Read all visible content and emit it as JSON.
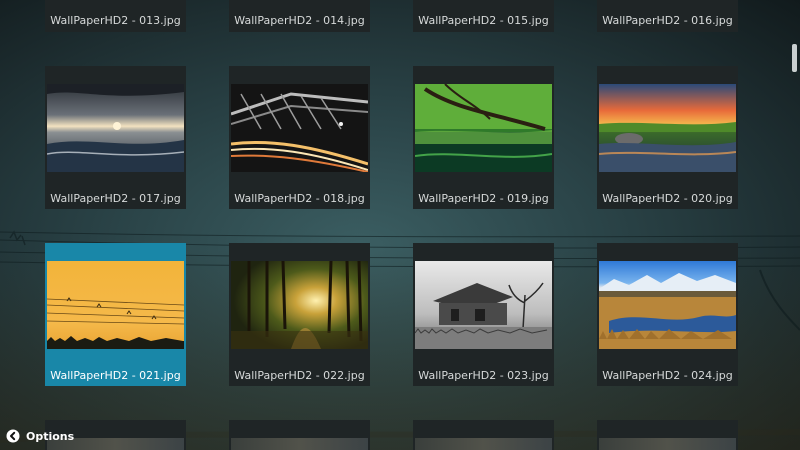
{
  "files": {
    "row_top": [
      "WallPaperHD2 - 013.jpg",
      "WallPaperHD2 - 014.jpg",
      "WallPaperHD2 - 015.jpg",
      "WallPaperHD2 - 016.jpg"
    ],
    "row1": [
      "WallPaperHD2 - 017.jpg",
      "WallPaperHD2 - 018.jpg",
      "WallPaperHD2 - 019.jpg",
      "WallPaperHD2 - 020.jpg"
    ],
    "row2": [
      "WallPaperHD2 - 021.jpg",
      "WallPaperHD2 - 022.jpg",
      "WallPaperHD2 - 023.jpg",
      "WallPaperHD2 - 024.jpg"
    ]
  },
  "selected_file": "WallPaperHD2 - 021.jpg",
  "footer": {
    "options_label": "Options",
    "options_icon": "options-chevron-icon"
  },
  "colors": {
    "selected": "#1987a8",
    "tile": "#1f2526",
    "text": "#d6d9d9"
  }
}
